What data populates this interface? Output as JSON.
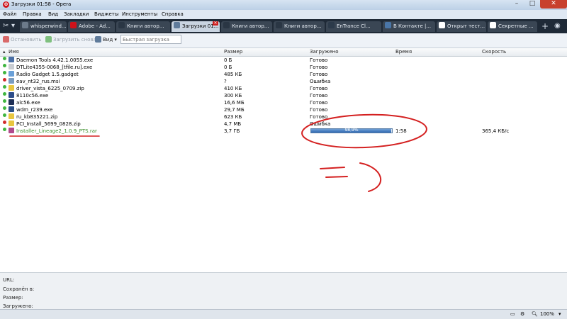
{
  "window": {
    "title": "Загрузки 01:58 - Opera",
    "minimize": "–",
    "maximize": "□",
    "close": "✕"
  },
  "menu": [
    "Файл",
    "Правка",
    "Вид",
    "Закладки",
    "Виджеты",
    "Инструменты",
    "Справка"
  ],
  "tabs": [
    {
      "label": "whisperwind...",
      "icon": "whisper-icon",
      "color": "#6c7a8a"
    },
    {
      "label": "Adobe - Ad...",
      "icon": "adobe-icon",
      "color": "#d0121a"
    },
    {
      "label": "Книги автор...",
      "icon": "book-icon",
      "color": "#3b4a5c"
    },
    {
      "label": "Загрузки 01...",
      "icon": "downloads-icon",
      "color": "#5f7b9b",
      "active": true
    },
    {
      "label": "Книги автор...",
      "icon": "book-icon",
      "color": "#3b4a5c"
    },
    {
      "label": "Книги автор...",
      "icon": "book-icon",
      "color": "#3b4a5c"
    },
    {
      "label": "EnTrance Cl...",
      "icon": "entrance-icon",
      "color": "#2c3a4a"
    },
    {
      "label": "В Контакте |...",
      "icon": "vk-icon",
      "color": "#4a76a8"
    },
    {
      "label": "Открыт тест...",
      "icon": "puzzle-icon",
      "color": "#ffffff"
    },
    {
      "label": "Секретные ...",
      "icon": "puzzle-icon",
      "color": "#ffffff"
    }
  ],
  "toolbar": {
    "stop": "Остановить",
    "reload": "Загрузить снова",
    "view": "Вид",
    "quick_placeholder": "Быстрая загрузка"
  },
  "columns": {
    "name": "Имя",
    "size": "Размер",
    "loaded": "Загружено",
    "time": "Время",
    "speed": "Скорость"
  },
  "downloads": [
    {
      "name": "Daemon Tools 4.42.1.0055.exe",
      "size": "0 Б",
      "loaded": "Готово",
      "time": "",
      "speed": "",
      "status": "ok",
      "icon_color": "#4a6fa5"
    },
    {
      "name": "DTLite4355-0068_[tfile.ru].exe",
      "size": "0 Б",
      "loaded": "Готово",
      "time": "",
      "speed": "",
      "status": "ok",
      "icon_color": "#c8ccd2"
    },
    {
      "name": "Radio Gadget 1.5.gadget",
      "size": "485 КБ",
      "loaded": "Готово",
      "time": "",
      "speed": "",
      "status": "ok",
      "icon_color": "#6aa0d8"
    },
    {
      "name": "eav_nt32_rus.msi",
      "size": "?",
      "loaded": "Ошибка",
      "time": "",
      "speed": "",
      "status": "error",
      "icon_color": "#7a9cc0"
    },
    {
      "name": "driver_vista_6225_0709.zip",
      "size": "410 КБ",
      "loaded": "Готово",
      "time": "",
      "speed": "",
      "status": "ok",
      "icon_color": "#e8c640"
    },
    {
      "name": "8110c56.exe",
      "size": "300 КБ",
      "loaded": "Готово",
      "time": "",
      "speed": "",
      "status": "ok",
      "icon_color": "#2d4d8a"
    },
    {
      "name": "alc56.exe",
      "size": "16,6 МБ",
      "loaded": "Готово",
      "time": "",
      "speed": "",
      "status": "ok",
      "icon_color": "#1f2f55"
    },
    {
      "name": "wdm_r239.exe",
      "size": "29,7 МБ",
      "loaded": "Готово",
      "time": "",
      "speed": "",
      "status": "ok",
      "icon_color": "#2b4f86"
    },
    {
      "name": "ru_kb835221.zip",
      "size": "623 КБ",
      "loaded": "Готово",
      "time": "",
      "speed": "",
      "status": "ok",
      "icon_color": "#e8c640"
    },
    {
      "name": "PCI_Install_5699_0828.zip",
      "size": "4,7 МБ",
      "loaded": "Ошибка",
      "time": "",
      "speed": "",
      "status": "error",
      "icon_color": "#e8c640"
    },
    {
      "name": "Installer_Lineage2_1.0.9_PTS.rar",
      "size": "3,7 ГБ",
      "loaded": "",
      "progress_label": "98,9%",
      "progress": 0.989,
      "time": "1:58",
      "speed": "365,4 КБ/с",
      "status": "active",
      "icon_color": "#b04a8c"
    }
  ],
  "details": {
    "url": "URL:",
    "saved": "Сохранён в:",
    "size": "Размер:",
    "loaded": "Загружено:"
  },
  "status": {
    "zoom": "100%"
  },
  "colors": {
    "ok": "#3fb53f",
    "error": "#d22b2b",
    "annotation": "#d42020"
  }
}
